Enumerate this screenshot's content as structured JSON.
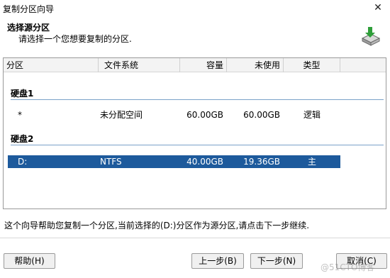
{
  "window": {
    "title": "复制分区向导"
  },
  "header": {
    "title": "选择源分区",
    "subtitle": "请选择一个您想要复制的分区."
  },
  "columns": [
    "分区",
    "文件系统",
    "容量",
    "未使用",
    "类型"
  ],
  "groups": [
    {
      "name": "硬盘1",
      "rows": [
        {
          "partition": "*",
          "fs": "未分配空间",
          "capacity": "60.00GB",
          "unused": "60.00GB",
          "type": "逻辑"
        }
      ]
    },
    {
      "name": "硬盘2",
      "rows": [
        {
          "partition": "D:",
          "fs": "NTFS",
          "capacity": "40.00GB",
          "unused": "19.36GB",
          "type": "主"
        }
      ]
    }
  ],
  "description": "这个向导帮助您复制一个分区,当前选择的(D:)分区作为源分区,请点击下一步继续.",
  "buttons": {
    "help": "帮助(H)",
    "prev": "上一步(B)",
    "next": "下一步(N)",
    "cancel": "取消(C)"
  },
  "watermark": "@51CTO博客",
  "icons": {
    "close": "close-icon",
    "wizard": "disk-copy-icon"
  },
  "colors": {
    "selection": "#1d5a9c",
    "group_line": "#7aa2c8"
  }
}
